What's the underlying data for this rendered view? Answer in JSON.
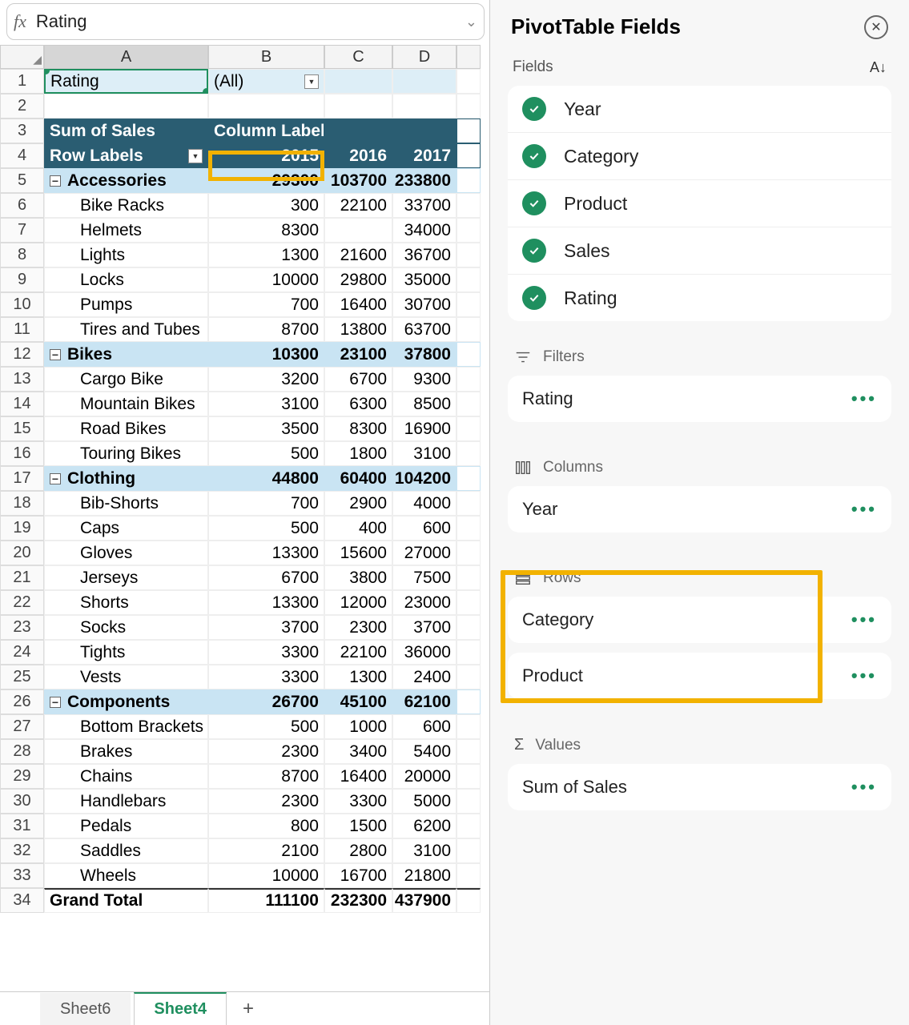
{
  "formula_bar": {
    "fx": "fx",
    "value": "Rating"
  },
  "columns": [
    "A",
    "B",
    "C",
    "D",
    ""
  ],
  "filter_row": {
    "label": "Rating",
    "value": "(All)"
  },
  "dark_header": {
    "a": "Sum of Sales",
    "b": "Column Labels"
  },
  "year_header": {
    "a": "Row Labels",
    "y1": "2015",
    "y2": "2016",
    "y3": "2017"
  },
  "data": [
    {
      "type": "cat",
      "n": 5,
      "a": "Accessories",
      "b": "29300",
      "c": "103700",
      "d": "233800"
    },
    {
      "type": "prod",
      "n": 6,
      "a": "Bike Racks",
      "b": "300",
      "c": "22100",
      "d": "33700"
    },
    {
      "type": "prod",
      "n": 7,
      "a": "Helmets",
      "b": "8300",
      "c": "",
      "d": "34000"
    },
    {
      "type": "prod",
      "n": 8,
      "a": "Lights",
      "b": "1300",
      "c": "21600",
      "d": "36700"
    },
    {
      "type": "prod",
      "n": 9,
      "a": "Locks",
      "b": "10000",
      "c": "29800",
      "d": "35000"
    },
    {
      "type": "prod",
      "n": 10,
      "a": "Pumps",
      "b": "700",
      "c": "16400",
      "d": "30700"
    },
    {
      "type": "prod",
      "n": 11,
      "a": "Tires and Tubes",
      "b": "8700",
      "c": "13800",
      "d": "63700"
    },
    {
      "type": "cat",
      "n": 12,
      "a": "Bikes",
      "b": "10300",
      "c": "23100",
      "d": "37800"
    },
    {
      "type": "prod",
      "n": 13,
      "a": "Cargo Bike",
      "b": "3200",
      "c": "6700",
      "d": "9300"
    },
    {
      "type": "prod",
      "n": 14,
      "a": "Mountain Bikes",
      "b": "3100",
      "c": "6300",
      "d": "8500"
    },
    {
      "type": "prod",
      "n": 15,
      "a": "Road Bikes",
      "b": "3500",
      "c": "8300",
      "d": "16900"
    },
    {
      "type": "prod",
      "n": 16,
      "a": "Touring Bikes",
      "b": "500",
      "c": "1800",
      "d": "3100"
    },
    {
      "type": "cat",
      "n": 17,
      "a": "Clothing",
      "b": "44800",
      "c": "60400",
      "d": "104200"
    },
    {
      "type": "prod",
      "n": 18,
      "a": "Bib-Shorts",
      "b": "700",
      "c": "2900",
      "d": "4000"
    },
    {
      "type": "prod",
      "n": 19,
      "a": "Caps",
      "b": "500",
      "c": "400",
      "d": "600"
    },
    {
      "type": "prod",
      "n": 20,
      "a": "Gloves",
      "b": "13300",
      "c": "15600",
      "d": "27000"
    },
    {
      "type": "prod",
      "n": 21,
      "a": "Jerseys",
      "b": "6700",
      "c": "3800",
      "d": "7500"
    },
    {
      "type": "prod",
      "n": 22,
      "a": "Shorts",
      "b": "13300",
      "c": "12000",
      "d": "23000"
    },
    {
      "type": "prod",
      "n": 23,
      "a": "Socks",
      "b": "3700",
      "c": "2300",
      "d": "3700"
    },
    {
      "type": "prod",
      "n": 24,
      "a": "Tights",
      "b": "3300",
      "c": "22100",
      "d": "36000"
    },
    {
      "type": "prod",
      "n": 25,
      "a": "Vests",
      "b": "3300",
      "c": "1300",
      "d": "2400"
    },
    {
      "type": "cat",
      "n": 26,
      "a": "Components",
      "b": "26700",
      "c": "45100",
      "d": "62100"
    },
    {
      "type": "prod",
      "n": 27,
      "a": "Bottom Brackets",
      "b": "500",
      "c": "1000",
      "d": "600"
    },
    {
      "type": "prod",
      "n": 28,
      "a": "Brakes",
      "b": "2300",
      "c": "3400",
      "d": "5400"
    },
    {
      "type": "prod",
      "n": 29,
      "a": "Chains",
      "b": "8700",
      "c": "16400",
      "d": "20000"
    },
    {
      "type": "prod",
      "n": 30,
      "a": "Handlebars",
      "b": "2300",
      "c": "3300",
      "d": "5000"
    },
    {
      "type": "prod",
      "n": 31,
      "a": "Pedals",
      "b": "800",
      "c": "1500",
      "d": "6200"
    },
    {
      "type": "prod",
      "n": 32,
      "a": "Saddles",
      "b": "2100",
      "c": "2800",
      "d": "3100"
    },
    {
      "type": "prod",
      "n": 33,
      "a": "Wheels",
      "b": "10000",
      "c": "16700",
      "d": "21800"
    }
  ],
  "grand_total": {
    "n": 34,
    "a": "Grand Total",
    "b": "111100",
    "c": "232300",
    "d": "437900"
  },
  "tabs": {
    "inactive": "Sheet6",
    "active": "Sheet4"
  },
  "panel": {
    "title": "PivotTable Fields",
    "fields_label": "Fields",
    "fields": [
      "Year",
      "Category",
      "Product",
      "Sales",
      "Rating"
    ],
    "filters_label": "Filters",
    "filters": [
      "Rating"
    ],
    "columns_label": "Columns",
    "columns": [
      "Year"
    ],
    "rows_label": "Rows",
    "rows": [
      "Category",
      "Product"
    ],
    "values_label": "Values",
    "values": [
      "Sum of Sales"
    ]
  }
}
